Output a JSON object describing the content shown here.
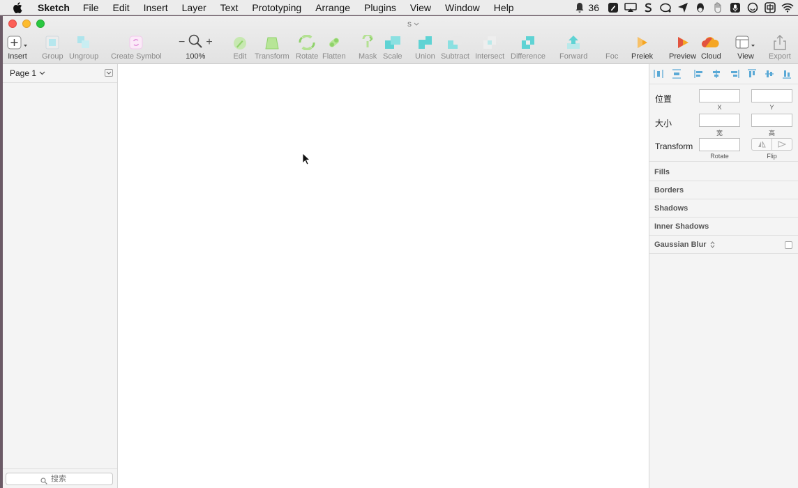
{
  "menubar": {
    "app_name": "Sketch",
    "items": [
      "File",
      "Edit",
      "Insert",
      "Layer",
      "Text",
      "Prototyping",
      "Arrange",
      "Plugins",
      "View",
      "Window",
      "Help"
    ],
    "notification_count": "36"
  },
  "window": {
    "doc_title": "s"
  },
  "toolbar": {
    "insert": "Insert",
    "group": "Group",
    "ungroup": "Ungroup",
    "create_symbol": "Create Symbol",
    "zoom_minus": "−",
    "zoom_plus": "+",
    "zoom_level": "100%",
    "edit": "Edit",
    "transform": "Transform",
    "rotate": "Rotate",
    "flatten": "Flatten",
    "mask": "Mask",
    "scale": "Scale",
    "union": "Union",
    "subtract": "Subtract",
    "intersect": "Intersect",
    "difference": "Difference",
    "forward": "Forward",
    "focus": "Foc",
    "preview_small": "Preiek",
    "preview": "Preview",
    "cloud": "Cloud",
    "view": "View",
    "export": "Export"
  },
  "pages": {
    "current": "Page 1",
    "search_placeholder": "搜索"
  },
  "inspector": {
    "position_label": "位置",
    "x_label": "X",
    "y_label": "Y",
    "size_label": "大小",
    "width_label": "宽",
    "height_label": "高",
    "transform_label": "Transform",
    "rotate_label": "Rotate",
    "flip_label": "Flip",
    "sections": {
      "fills": "Fills",
      "borders": "Borders",
      "shadows": "Shadows",
      "inner_shadows": "Inner Shadows",
      "gaussian_blur": "Gaussian Blur"
    }
  },
  "colors": {
    "accent_teal": "#5fd3d4",
    "accent_green": "#8fd26a",
    "accent_orange": "#f5a623",
    "symbol_pink": "#e08ad8"
  }
}
